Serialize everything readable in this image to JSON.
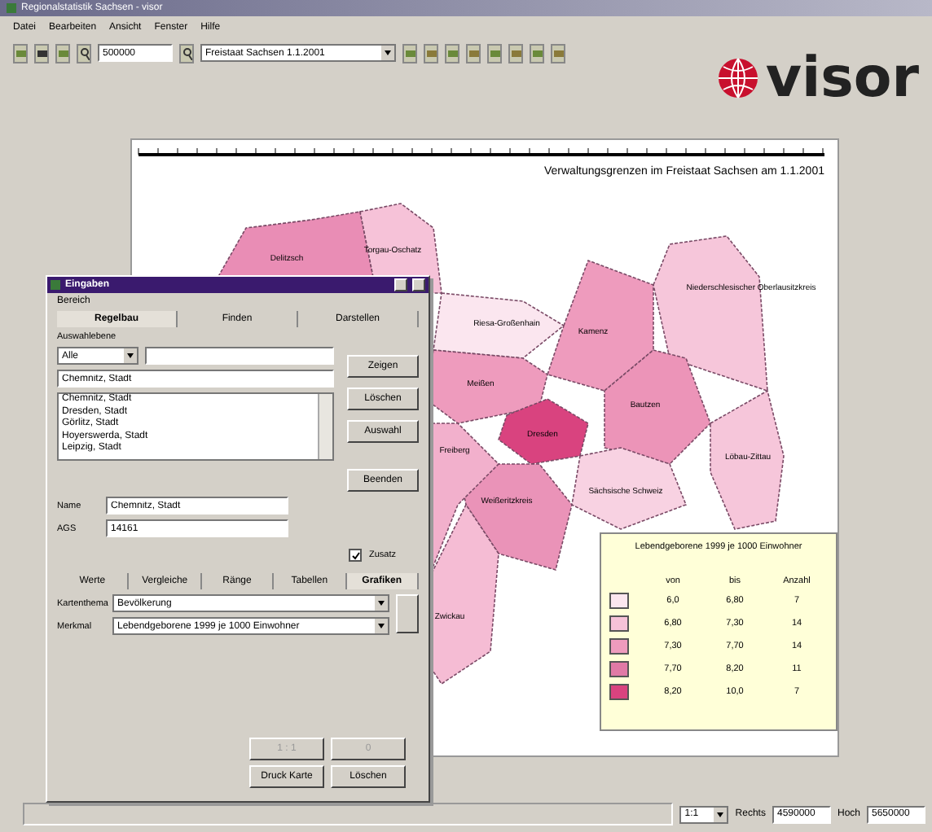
{
  "window": {
    "title": "Regionalstatistik Sachsen - visor"
  },
  "menu": [
    "Datei",
    "Bearbeiten",
    "Ansicht",
    "Fenster",
    "Hilfe"
  ],
  "toolbar": {
    "scale": "500000",
    "region_select": "Freistaat Sachsen 1.1.2001"
  },
  "logo": "visor",
  "map": {
    "title": "Verwaltungsgrenzen im Freistaat Sachsen am 1.1.2001",
    "regions": [
      {
        "name": "Delitzsch",
        "color": "#e98db5"
      },
      {
        "name": "Torgau-Oschatz",
        "color": "#f6c2d8"
      },
      {
        "name": "Riesa-Großenhain",
        "color": "#fbe6ef"
      },
      {
        "name": "Kamenz",
        "color": "#ee9bbd"
      },
      {
        "name": "Niederschlesischer Oberlausitzkreis",
        "color": "#f6c6da"
      },
      {
        "name": "Bautzen",
        "color": "#ec94b8"
      },
      {
        "name": "Löbau-Zittau",
        "color": "#f6c6da"
      },
      {
        "name": "Meißen",
        "color": "#ee9bbd"
      },
      {
        "name": "Dresden",
        "color": "#d9437f"
      },
      {
        "name": "Sächsische Schweiz",
        "color": "#f8d2e2"
      },
      {
        "name": "Weißeritzkreis",
        "color": "#ea93b8"
      },
      {
        "name": "Freiberg",
        "color": "#f2b0cc"
      },
      {
        "name": "Zwickau",
        "color": "#f5bcd4"
      }
    ]
  },
  "legend": {
    "title": "Lebendgeborene 1999 je 1000 Einwohner",
    "columns": [
      "von",
      "bis",
      "Anzahl"
    ],
    "rows": [
      {
        "color": "#fbe6ef",
        "from": "6,0",
        "to": "6,80",
        "count": "7"
      },
      {
        "color": "#f6c2d8",
        "from": "6,80",
        "to": "7,30",
        "count": "14"
      },
      {
        "color": "#ee9bbd",
        "from": "7,30",
        "to": "7,70",
        "count": "14"
      },
      {
        "color": "#e07aa6",
        "from": "7,70",
        "to": "8,20",
        "count": "11"
      },
      {
        "color": "#d9437f",
        "from": "8,20",
        "to": "10,0",
        "count": "7"
      }
    ]
  },
  "dialog": {
    "title": "Eingaben",
    "menu": "Bereich",
    "tabs": [
      {
        "label": "Regelbau",
        "selected": true
      },
      {
        "label": "Finden",
        "selected": false
      },
      {
        "label": "Darstellen",
        "selected": false
      }
    ],
    "level_label": "Auswahlebene",
    "level_select": "Alle",
    "name_entry": "Chemnitz, Stadt",
    "list": [
      {
        "label": "Chemnitz, Stadt",
        "selected": false
      },
      {
        "label": "Dresden, Stadt",
        "selected": false
      },
      {
        "label": "Görlitz, Stadt",
        "selected": false
      },
      {
        "label": "Hoyerswerda, Stadt",
        "selected": false
      },
      {
        "label": "Leipzig, Stadt",
        "selected": false
      }
    ],
    "buttons": [
      "Zeigen",
      "Löschen",
      "Auswahl",
      "Beenden"
    ],
    "fields": [
      {
        "label": "Name",
        "value": "Chemnitz, Stadt"
      },
      {
        "label": "AGS",
        "value": "14161"
      }
    ],
    "extra": {
      "label": "Zusatz",
      "checked": true
    },
    "lower_tabs": [
      {
        "label": "Werte",
        "selected": false
      },
      {
        "label": "Vergleiche",
        "selected": false
      },
      {
        "label": "Ränge",
        "selected": false
      },
      {
        "label": "Tabellen",
        "selected": false
      },
      {
        "label": "Grafiken",
        "selected": true
      }
    ],
    "selects": [
      {
        "label": "Kartenthema",
        "value": "Bevölkerung"
      },
      {
        "label": "Merkmal",
        "value": "Lebendgeborene 1999 je 1000 Einwohner"
      }
    ],
    "bottom_buttons": [
      {
        "label": "1 : 1",
        "disabled": true
      },
      {
        "label": "0",
        "disabled": true
      },
      {
        "label": "Druck Karte",
        "disabled": false
      },
      {
        "label": "Löschen",
        "disabled": false
      }
    ]
  },
  "status_bar": {
    "scale": "1:1",
    "right_label": "Rechts",
    "right_value": "4590000",
    "up_label": "Hoch",
    "up_value": "5650000"
  }
}
